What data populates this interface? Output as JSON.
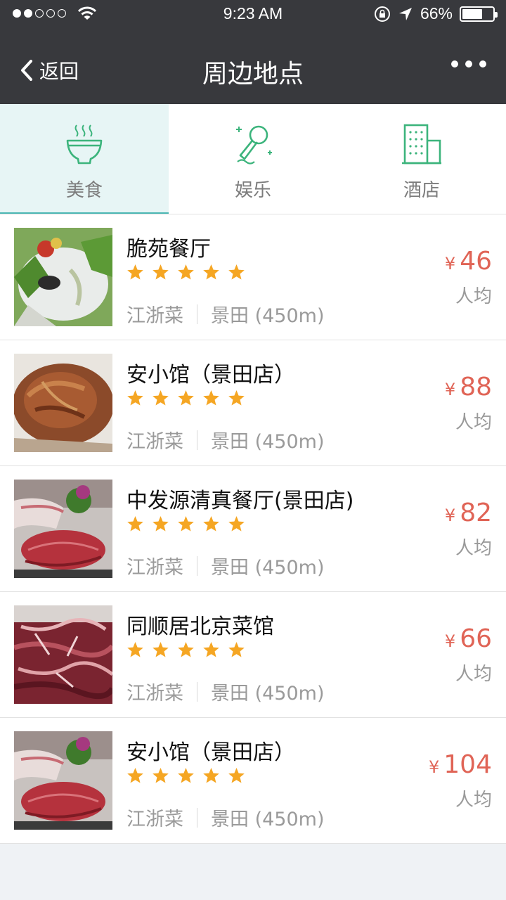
{
  "status_bar": {
    "time": "9:23 AM",
    "battery": "66%",
    "signal_dots_filled": 2,
    "signal_dots_total": 5,
    "battery_level": 0.66
  },
  "nav": {
    "back_label": "返回",
    "title": "周边地点"
  },
  "tabs": [
    {
      "label": "美食",
      "icon": "rice-bowl-icon",
      "active": true
    },
    {
      "label": "娱乐",
      "icon": "microphone-icon",
      "active": false
    },
    {
      "label": "酒店",
      "icon": "hotel-building-icon",
      "active": false
    }
  ],
  "places": [
    {
      "name": "脆苑餐厅",
      "rating": 5,
      "cuisine": "江浙菜",
      "location": "景田 (450m)",
      "currency": "¥",
      "price": "46",
      "per_person": "人均",
      "image": "salad-dish-photo"
    },
    {
      "name": "安小馆（景田店）",
      "rating": 5,
      "cuisine": "江浙菜",
      "location": "景田 (450m)",
      "currency": "¥",
      "price": "88",
      "per_person": "人均",
      "image": "braised-dish-photo"
    },
    {
      "name": "中发源清真餐厅(景田店)",
      "rating": 5,
      "cuisine": "江浙菜",
      "location": "景田 (450m)",
      "currency": "¥",
      "price": "82",
      "per_person": "人均",
      "image": "beef-platter-photo"
    },
    {
      "name": "同顺居北京菜馆",
      "rating": 5,
      "cuisine": "江浙菜",
      "location": "景田 (450m)",
      "currency": "¥",
      "price": "66",
      "per_person": "人均",
      "image": "sliced-meat-photo"
    },
    {
      "name": "安小馆（景田店）",
      "rating": 5,
      "cuisine": "江浙菜",
      "location": "景田 (450m)",
      "currency": "¥",
      "price": "104",
      "per_person": "人均",
      "image": "beef-platter-photo"
    }
  ],
  "colors": {
    "nav_bg": "#38393d",
    "accent": "#4ab6b3",
    "price": "#e06456",
    "star": "#f5a623",
    "active_tab_bg": "#e7f5f5"
  }
}
